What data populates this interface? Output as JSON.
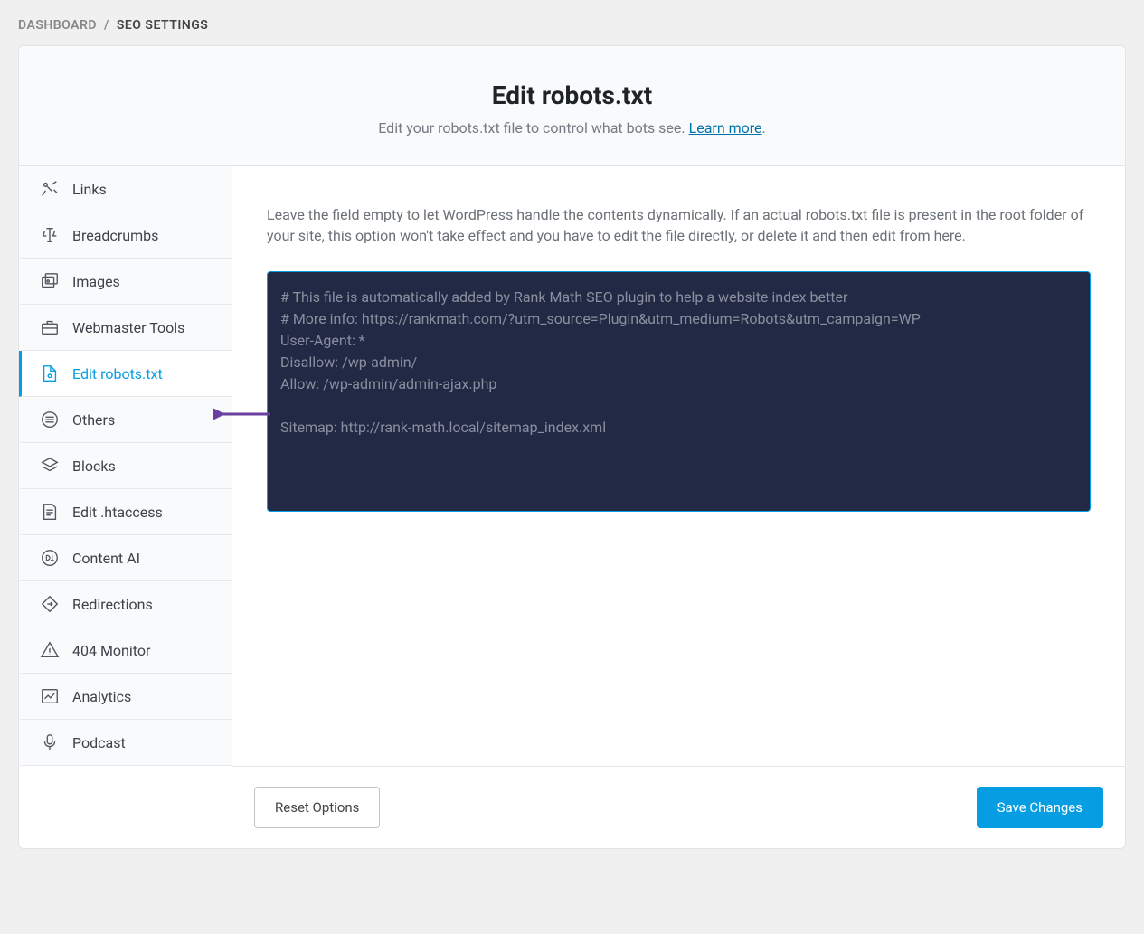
{
  "breadcrumb": {
    "root": "Dashboard",
    "current": "SEO Settings"
  },
  "header": {
    "title": "Edit robots.txt",
    "subtitle_prefix": "Edit your robots.txt file to control what bots see. ",
    "learn_more": "Learn more"
  },
  "sidebar": {
    "items": [
      {
        "id": "links",
        "label": "Links"
      },
      {
        "id": "breadcrumbs",
        "label": "Breadcrumbs"
      },
      {
        "id": "images",
        "label": "Images"
      },
      {
        "id": "webmaster-tools",
        "label": "Webmaster Tools"
      },
      {
        "id": "edit-robots",
        "label": "Edit robots.txt"
      },
      {
        "id": "others",
        "label": "Others"
      },
      {
        "id": "blocks",
        "label": "Blocks"
      },
      {
        "id": "edit-htaccess",
        "label": "Edit .htaccess"
      },
      {
        "id": "content-ai",
        "label": "Content AI"
      },
      {
        "id": "redirections",
        "label": "Redirections"
      },
      {
        "id": "404-monitor",
        "label": "404 Monitor"
      },
      {
        "id": "analytics",
        "label": "Analytics"
      },
      {
        "id": "podcast",
        "label": "Podcast"
      }
    ]
  },
  "content": {
    "description": "Leave the field empty to let WordPress handle the contents dynamically. If an actual robots.txt file is present in the root folder of your site, this option won't take effect and you have to edit the file directly, or delete it and then edit from here.",
    "robots_txt": "# This file is automatically added by Rank Math SEO plugin to help a website index better\n# More info: https://rankmath.com/?utm_source=Plugin&utm_medium=Robots&utm_campaign=WP\nUser-Agent: *\nDisallow: /wp-admin/\nAllow: /wp-admin/admin-ajax.php\n\nSitemap: http://rank-math.local/sitemap_index.xml"
  },
  "footer": {
    "reset": "Reset Options",
    "save": "Save Changes"
  }
}
